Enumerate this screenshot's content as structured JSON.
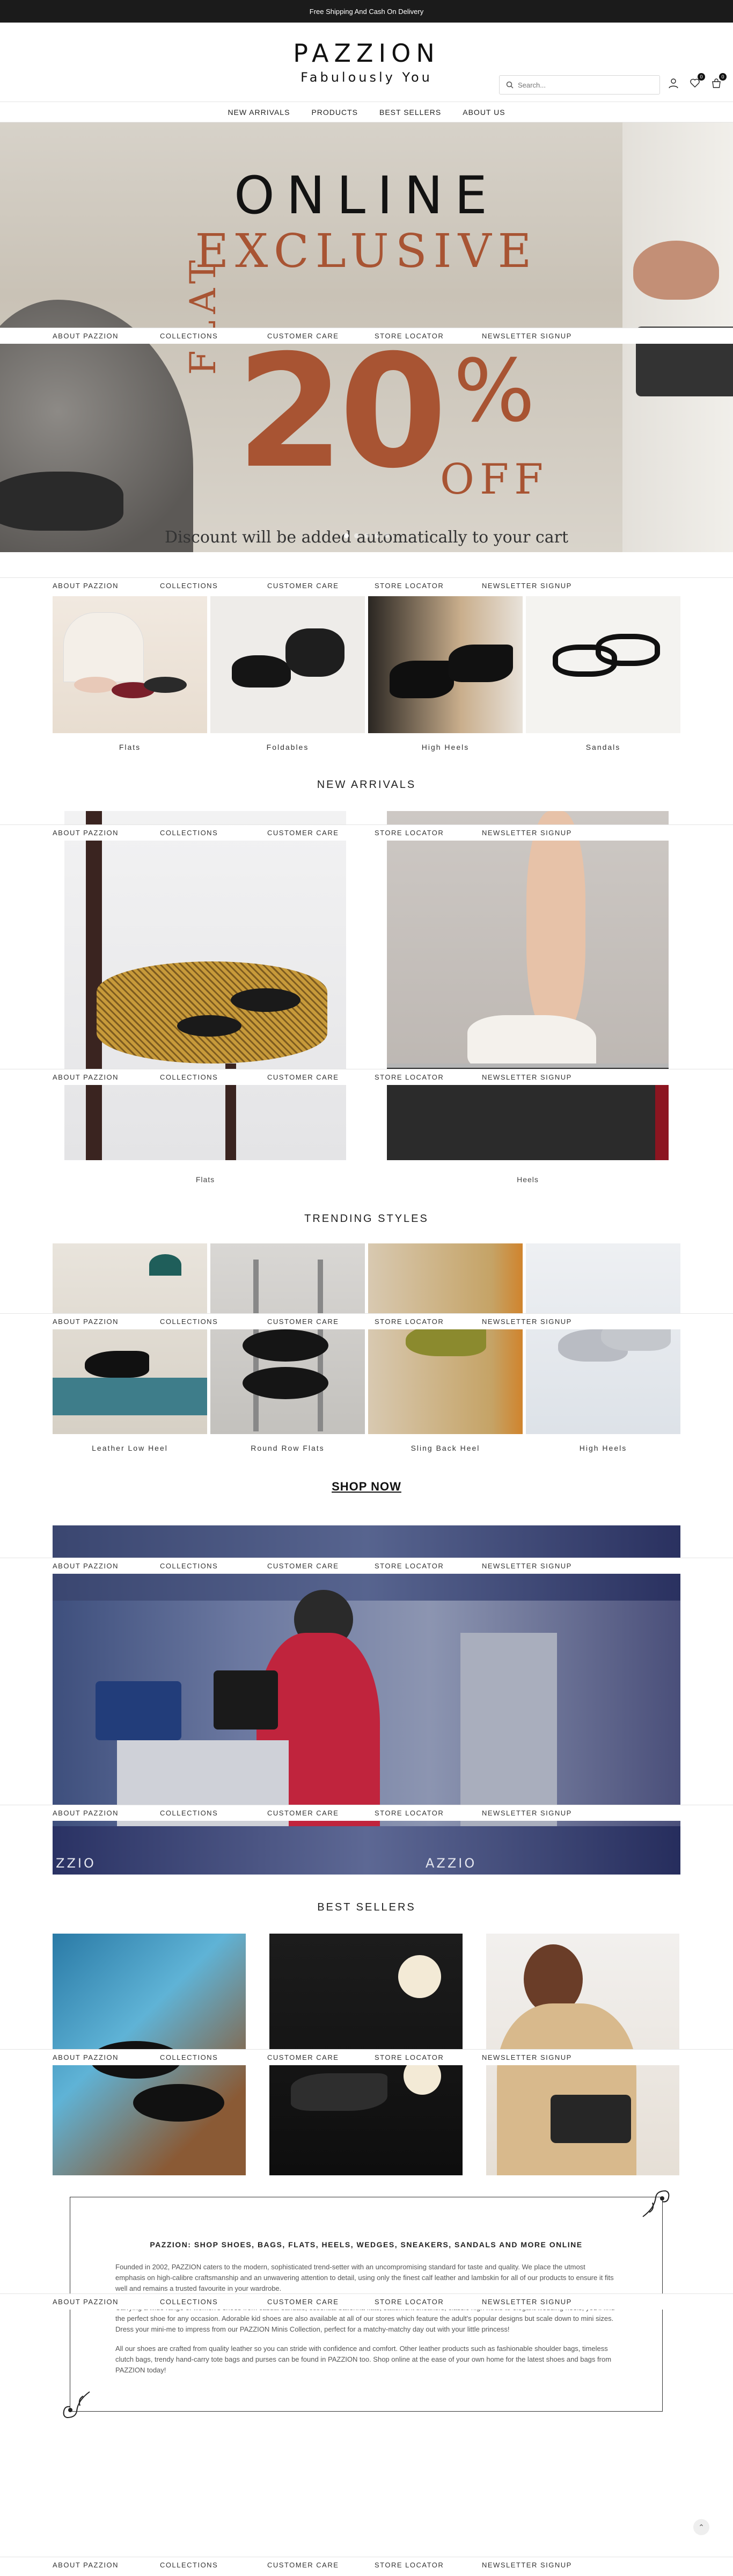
{
  "announcement": "Free Shipping And Cash On Delivery",
  "brand": {
    "name": "PAZZION",
    "tagline": "Fabulously You"
  },
  "search": {
    "placeholder": "Search..."
  },
  "header_icons": {
    "wishlist_count": "0",
    "cart_count": "0"
  },
  "nav": [
    "NEW ARRIVALS",
    "PRODUCTS",
    "BEST SELLERS",
    "ABOUT US"
  ],
  "hero": {
    "line1": "ONLINE",
    "line2": "EXCLUSIVE",
    "flat": "FLAT",
    "percent": "20",
    "percent_sign": "%",
    "off": "OFF",
    "note": "Discount will be added automatically to your cart",
    "slides": 5,
    "active_slide": 1
  },
  "footer_links": [
    "ABOUT PAZZION",
    "COLLECTIONS",
    "CUSTOMER CARE",
    "STORE LOCATOR",
    "NEWSLETTER SIGNUP"
  ],
  "categories": [
    "Flats",
    "Foldables",
    "High Heels",
    "Sandals"
  ],
  "new_arrivals": {
    "title": "NEW ARRIVALS",
    "items": [
      "Flats",
      "Heels"
    ]
  },
  "trending": {
    "title": "TRENDING STYLES",
    "items": [
      "Leather Low Heel",
      "Round Row Flats",
      "Sling Back Heel",
      "High Heels"
    ]
  },
  "shop_now": "SHOP NOW",
  "banner_text": [
    "ZZIO",
    "AZZIO"
  ],
  "best_sellers": {
    "title": "BEST SELLERS"
  },
  "about": {
    "heading": "PAZZION: SHOP SHOES, BAGS, FLATS, HEELS, WEDGES, SNEAKERS, SANDALS AND MORE ONLINE",
    "p1": "Founded in 2002, PAZZION caters to the modern, sophisticated trend-setter with an uncompromising standard for taste and quality. We place the utmost emphasis on high-calibre craftsmanship and an unwavering attention to detail, using only the finest calf leather and lambskin for all of our products to ensure it fits well and remains a trusted favourite in your wardrobe.",
    "p2": "Carrying a wide range of women's shoes from casual sandals, essential ballerina flats, statement sneakers, classic high heels to elegant wedding heels, you'll find the perfect shoe for any occasion. Adorable kid shoes are also available at all of our stores which feature the adult's popular designs but scale down to mini sizes. Dress your mini-me to impress from our PAZZION Minis Collection, perfect for a matchy-matchy day out with your little princess!",
    "p3": "All our shoes are crafted from quality leather so you can stride with confidence and comfort. Other leather products such as fashionable shoulder bags, timeless clutch bags, trendy hand-carry tote bags and purses can be found in PAZZION too. Shop online at the ease of your own home for the latest shoes and bags from PAZZION today!"
  }
}
